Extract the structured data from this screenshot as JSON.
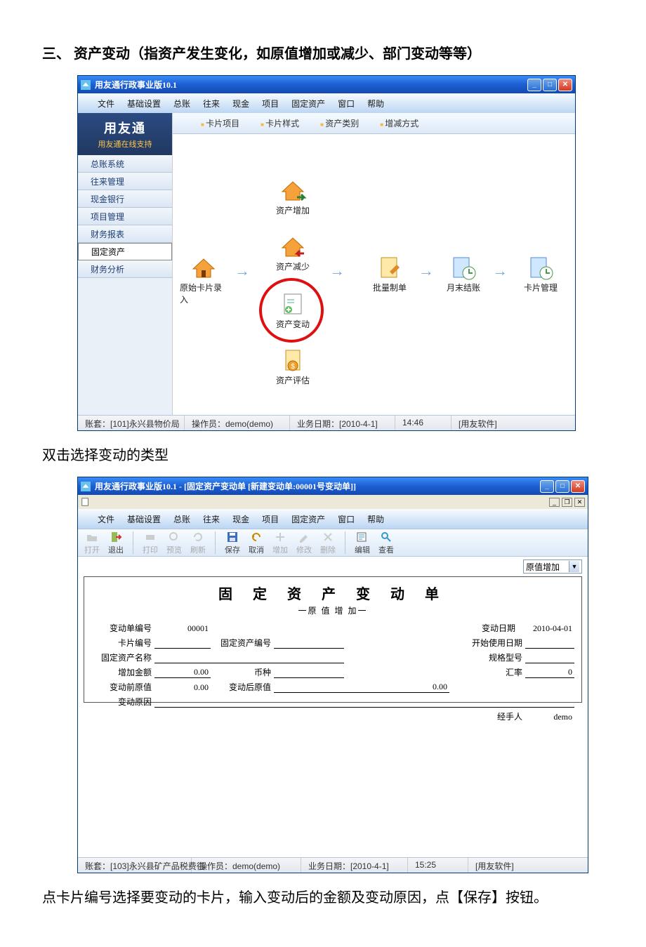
{
  "doc": {
    "heading": "三、 资产变动（指资产发生变化，如原值增加或减少、部门变动等等）",
    "mid_text": "双击选择变动的类型",
    "bottom_text": "点卡片编号选择要变动的卡片，输入变动后的金额及变动原因，点【保存】按钮。"
  },
  "win1": {
    "title": "用友通行政事业版10.1",
    "menus": [
      "文件",
      "基础设置",
      "总账",
      "往来",
      "现金",
      "项目",
      "固定资产",
      "窗口",
      "帮助"
    ],
    "brand_line1": "用友通",
    "brand_line2": "用友通在线支持",
    "sidebar_items": [
      "总账系统",
      "往来管理",
      "现金银行",
      "项目管理",
      "财务报表",
      "固定资产",
      "财务分析"
    ],
    "active_sidebar": "固定资产",
    "tabs": [
      "卡片项目",
      "卡片样式",
      "资产类别",
      "增减方式"
    ],
    "nodes": {
      "card_in": "原始卡片录入",
      "asset_add": "资产增加",
      "asset_sub": "资产减少",
      "asset_change": "资产变动",
      "asset_eval": "资产评估",
      "batch": "批量制单",
      "monthend": "月末结账",
      "card_mgmt": "卡片管理"
    },
    "status": {
      "acct": "账套：[101]永兴县物价局",
      "oper": "操作员：demo(demo)",
      "bizdate": "业务日期：[2010-4-1]",
      "time": "14:46",
      "company": "[用友软件]"
    }
  },
  "win2": {
    "title": "用友通行政事业版10.1 - [固定资产变动单 [新建变动单:00001号变动单]]",
    "menus": [
      "文件",
      "基础设置",
      "总账",
      "往来",
      "现金",
      "项目",
      "固定资产",
      "窗口",
      "帮助"
    ],
    "toolbar": {
      "open": "打开",
      "exit": "退出",
      "print": "打印",
      "preview": "预览",
      "refresh": "刷新",
      "save": "保存",
      "cancel": "取消",
      "add": "增加",
      "modify": "修改",
      "delete": "删除",
      "edit": "编辑",
      "view": "查看"
    },
    "combo_value": "原值增加",
    "form": {
      "title": "固 定 资 产 变 动 单",
      "subtitle": "一原 值 增 加一",
      "labels": {
        "doc_no": "变动单编号",
        "doc_date": "变动日期",
        "card_no": "卡片编号",
        "asset_no": "固定资产编号",
        "start_date": "开始使用日期",
        "asset_name": "固定资产名称",
        "spec": "规格型号",
        "add_amt": "增加金额",
        "currency": "币种",
        "rate": "汇率",
        "before": "变动前原值",
        "after": "变动后原值",
        "reason": "变动原因",
        "handler": "经手人"
      },
      "values": {
        "doc_no": "00001",
        "doc_date": "2010-04-01",
        "card_no": "",
        "asset_no": "",
        "start_date": "",
        "asset_name": "",
        "spec": "",
        "add_amt": "0.00",
        "currency": "",
        "rate": "0",
        "before": "0.00",
        "after": "0.00",
        "reason": "",
        "handler": "demo"
      }
    },
    "status": {
      "acct": "账套：[103]永兴县矿产品税费征",
      "oper": "操作员：demo(demo)",
      "bizdate": "业务日期：[2010-4-1]",
      "time": "15:25",
      "company": "[用友软件]"
    }
  }
}
